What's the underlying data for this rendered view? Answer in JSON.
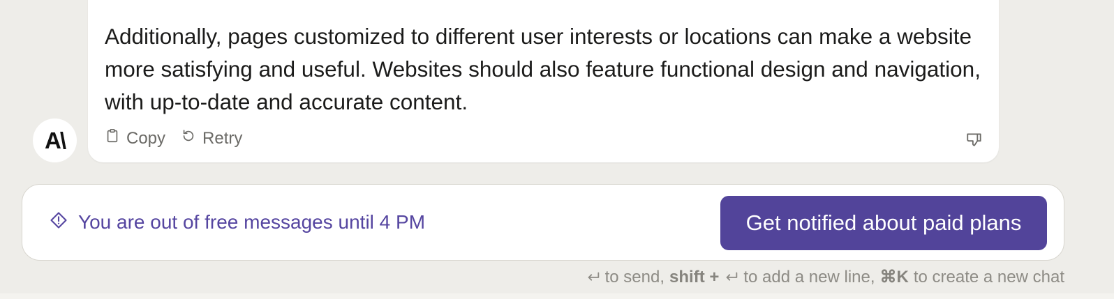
{
  "message": {
    "text": "Additionally, pages customized to different user interests or locations can make a website more satisfying and useful. Websites should also feature functional design and navigation, with up-to-date and accurate content.",
    "actions": {
      "copy_label": "Copy",
      "retry_label": "Retry"
    }
  },
  "assistant_avatar": {
    "logo_text": "A\\"
  },
  "banner": {
    "info_text": "You are out of free messages until 4 PM",
    "cta_label": "Get notified about paid plans"
  },
  "hint": {
    "to_send": "to send,",
    "shift_plus": "shift +",
    "to_add_line": "to add a new line,",
    "shortcut": "⌘K",
    "to_new_chat": "to create a new chat"
  },
  "colors": {
    "background": "#eeede9",
    "accent": "#52449a",
    "info_text": "#5545a0"
  }
}
